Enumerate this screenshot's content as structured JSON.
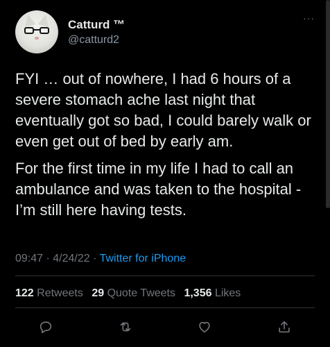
{
  "tweet": {
    "author": {
      "display_name": "Catturd ™",
      "handle": "@catturd2"
    },
    "more_label": "···",
    "paragraphs": [
      "FYI … out of nowhere, I had 6 hours of a severe stomach ache last night that eventually got so bad, I could barely walk or even get out of bed by early am.",
      "For the first time in my life I had to call an ambulance and was taken to the hospital - I’m still here having tests."
    ],
    "time": "09:47",
    "date": "4/24/22",
    "separator": "·",
    "source": "Twitter for iPhone",
    "stats": {
      "retweets_count": "122",
      "retweets_label": "Retweets",
      "quotes_count": "29",
      "quotes_label": "Quote Tweets",
      "likes_count": "1,356",
      "likes_label": "Likes"
    },
    "actions": {
      "reply_icon": "reply-icon",
      "retweet_icon": "retweet-icon",
      "like_icon": "like-icon",
      "share_icon": "share-icon"
    }
  },
  "colors": {
    "background": "#000000",
    "text": "#e7e9ea",
    "muted": "#71767b",
    "link": "#1d9bf0",
    "divider": "#2f3336"
  }
}
